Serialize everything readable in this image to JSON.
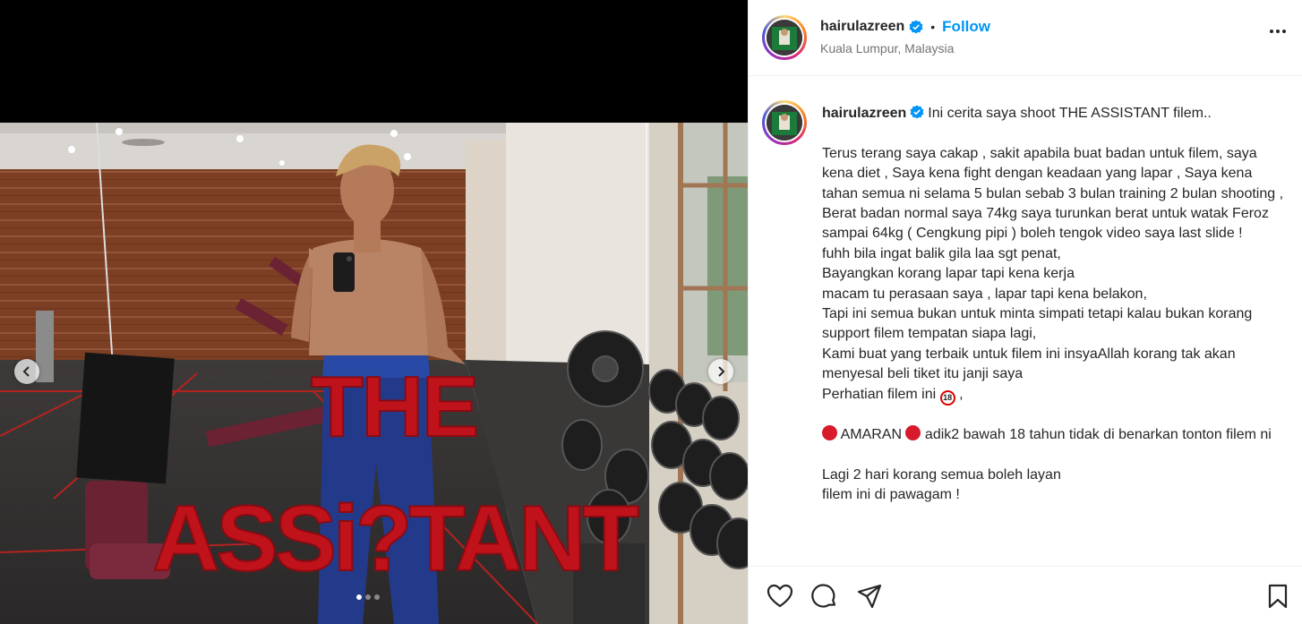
{
  "header": {
    "username": "hairulazreen",
    "separator": "•",
    "follow_label": "Follow",
    "location": "Kuala Lumpur, Malaysia",
    "more_icon": "more-horizontal-icon"
  },
  "media": {
    "overlay_title_line1": "THE",
    "overlay_title_line2": "ASSi?TANT",
    "carousel_count": 3,
    "carousel_active": 1,
    "prev_icon": "chevron-left-icon",
    "next_icon": "chevron-right-icon"
  },
  "caption": {
    "username": "hairulazreen",
    "first_line": "Ini cerita saya shoot THE ASSISTANT filem..",
    "body1": "Terus terang saya cakap , sakit apabila buat badan untuk filem, saya kena diet , Saya kena fight dengan keadaan yang lapar , Saya kena tahan semua ni selama 5 bulan sebab 3 bulan training 2 bulan shooting ,\nBerat badan normal saya 74kg saya turunkan berat untuk watak Feroz sampai 64kg ( Cengkung pipi ) boleh tengok video saya last slide !\nfuhh bila ingat balik gila laa sgt penat,\nBayangkan korang lapar tapi kena kerja\nmacam tu perasaan saya , lapar tapi kena belakon,\nTapi ini semua bukan untuk minta simpati tetapi kalau bukan korang support filem tempatan siapa lagi,\nKami buat yang terbaik untuk filem ini insyaAllah korang tak akan menyesal beli tiket itu janji saya\nPerhatian filem ini",
    "body1_tail": " ,",
    "age_badge": "18",
    "warning_word": "AMARAN",
    "warning_text": " adik2 bawah 18 tahun tidak di benarkan tonton filem ni",
    "body2": "Lagi 2 hari korang semua boleh layan\nfilem ini di pawagam !"
  },
  "actions": {
    "like_icon": "heart-icon",
    "comment_icon": "comment-icon",
    "share_icon": "share-icon",
    "save_icon": "bookmark-icon"
  },
  "colors": {
    "accent": "#0095f6",
    "verified": "#0095f6",
    "title_red": "#c0121b"
  }
}
